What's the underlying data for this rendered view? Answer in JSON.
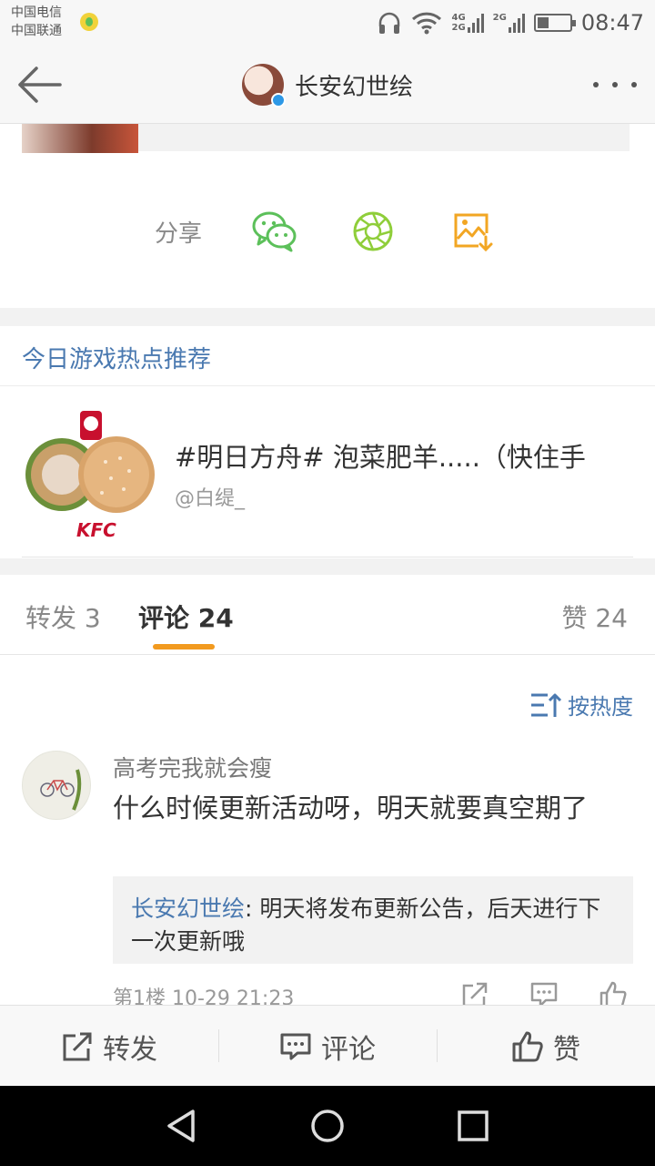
{
  "status_bar": {
    "carrier_1": "中国电信",
    "carrier_2": "中国联通",
    "net_1_top": "4G",
    "net_1_bottom": "2G",
    "net_2": "2G",
    "battery_level": 0.35,
    "time": "08:47"
  },
  "header": {
    "title": "长安幻世绘",
    "back_icon": "arrow-left-icon",
    "more_icon": "more-dots-icon"
  },
  "share": {
    "label": "分享",
    "icons": [
      "wechat-icon",
      "moments-icon",
      "save-image-icon"
    ]
  },
  "recommend": {
    "section_title": "今日游戏热点推荐",
    "item_text": "#明日方舟# 泡菜肥羊.....（快住手",
    "item_author": "@白缇_",
    "thumb_text": "KFC"
  },
  "tabs": {
    "repost": "转发 3",
    "comment": "评论 24",
    "like": "赞 24"
  },
  "comments": {
    "sort_label": "按热度",
    "items": [
      {
        "name": "高考完我就会瘦",
        "text": "什么时候更新活动呀，明天就要真空期了",
        "reply_name": "长安幻世绘",
        "reply_sep": ": ",
        "reply_text": "明天将发布更新公告，后天进行下一次更新哦",
        "meta": "第1楼 10-29 21:23"
      }
    ]
  },
  "toolbar": {
    "repost": "转发",
    "comment": "评论",
    "like": "赞"
  },
  "colors": {
    "link_blue": "#4a79b0",
    "accent_orange": "#f29a1f",
    "wechat_green": "#5cc05a",
    "moments_green": "#8fce3a",
    "save_orange": "#f2a623"
  }
}
